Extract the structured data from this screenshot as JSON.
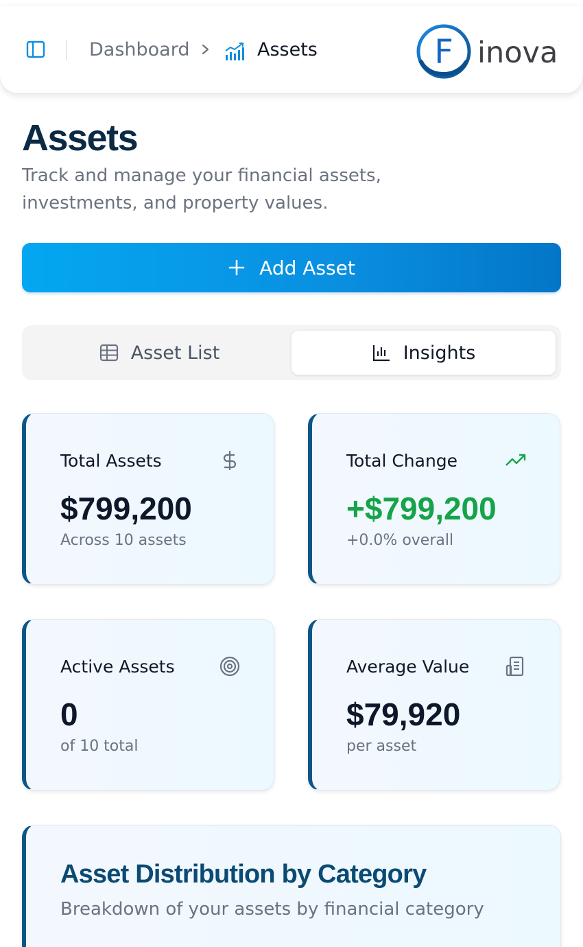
{
  "header": {
    "breadcrumb": {
      "root": "Dashboard",
      "current": "Assets"
    },
    "logo": {
      "letter": "F",
      "word": "inova"
    }
  },
  "page": {
    "title": "Assets",
    "subtitle": "Track and manage your financial assets, investments, and property values."
  },
  "actions": {
    "add_asset_label": "Add Asset"
  },
  "tabs": [
    {
      "label": "Asset List",
      "icon": "table-icon",
      "active": false
    },
    {
      "label": "Insights",
      "icon": "bar-chart-icon",
      "active": true
    }
  ],
  "stats": [
    {
      "title": "Total Assets",
      "icon": "dollar-icon",
      "value": "$799,200",
      "sub": "Across 10 assets"
    },
    {
      "title": "Total Change",
      "icon": "trending-up-icon",
      "value": "+$799,200",
      "sub": "+0.0% overall"
    },
    {
      "title": "Active Assets",
      "icon": "target-icon",
      "value": "0",
      "sub": "of 10 total"
    },
    {
      "title": "Average Value",
      "icon": "receipt-icon",
      "value": "$79,920",
      "sub": "per asset"
    }
  ],
  "distribution": {
    "title": "Asset Distribution by Category",
    "subtitle": "Breakdown of your assets by financial category"
  },
  "colors": {
    "accent": "#0a8ee0",
    "card_border": "#0b5687",
    "positive": "#16a34a",
    "title_dark": "#0b2a45"
  }
}
